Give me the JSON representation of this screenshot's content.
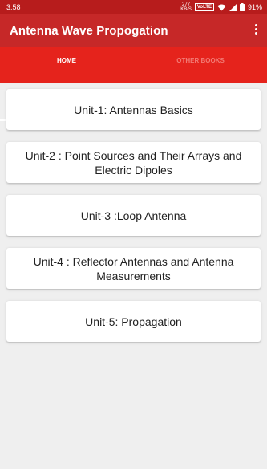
{
  "status_bar": {
    "time": "3:58",
    "net_speed_value": "277",
    "net_speed_unit": "KB/S",
    "volte": "VoLTE",
    "battery": "91%"
  },
  "app_bar": {
    "title": "Antenna Wave Propogation",
    "menu_icon": "more-vert-icon"
  },
  "tabs": [
    {
      "label": "HOME",
      "selected": true
    },
    {
      "label": "OTHER BOOKS",
      "selected": false
    }
  ],
  "units": [
    {
      "label": "Unit-1: Antennas Basics"
    },
    {
      "label": "Unit-2 : Point Sources and Their Arrays and Electric Dipoles"
    },
    {
      "label": "Unit-3 :Loop Antenna"
    },
    {
      "label": "Unit-4 : Reflector Antennas and Antenna Measurements"
    },
    {
      "label": "Unit-5: Propagation"
    }
  ],
  "colors": {
    "status_bar": "#b71c1c",
    "app_bar": "#c62828",
    "tab_bar": "#e5231c",
    "background": "#efefef"
  }
}
